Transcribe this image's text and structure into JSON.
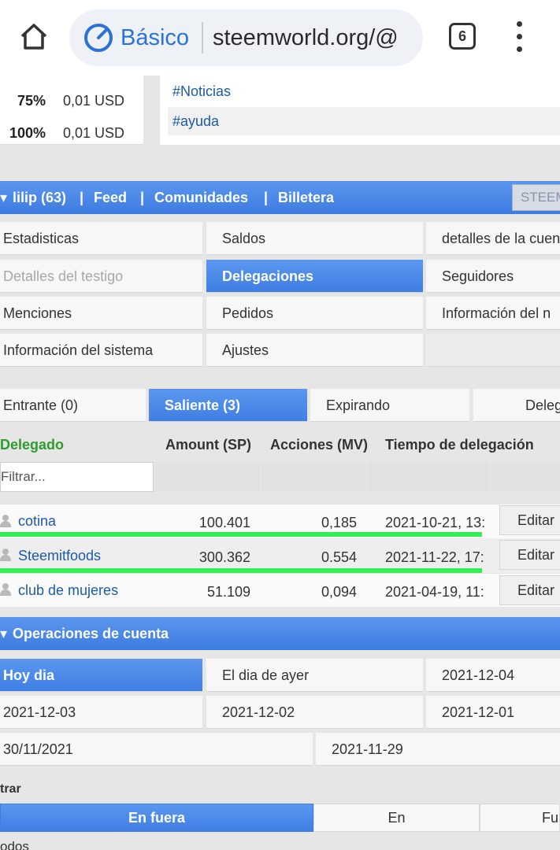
{
  "browser": {
    "mode_label": "Básico",
    "url": "steemworld.org/@",
    "tab_count": "6"
  },
  "prices": [
    {
      "pct": "75%",
      "usd": "0,01 USD"
    },
    {
      "pct": "100%",
      "usd": "0,01 USD"
    }
  ],
  "tags": [
    "#Noticias",
    "#ayuda"
  ],
  "nav": {
    "user": "lilip (63)",
    "sep": "|",
    "feed": "Feed",
    "communities": "Comunidades",
    "wallet": "Billetera",
    "steem": "STEEM"
  },
  "menu": {
    "stats": "Estadisticas",
    "balances": "Saldos",
    "account_details": "detalles de la cuenta",
    "witness_details": "Detalles del testigo",
    "delegations": "Delegaciones",
    "followers": "Seguidores",
    "mentions": "Menciones",
    "orders": "Pedidos",
    "info": "Información del n",
    "system_info": "Información del sistema",
    "settings": "Ajustes"
  },
  "deleg_tabs": {
    "incoming": "Entrante (0)",
    "outgoing": "Saliente (3)",
    "expiring": "Expirando",
    "delegate": "Deleg"
  },
  "table": {
    "headers": {
      "delegatee": "Delegado",
      "amount": "Amount (SP)",
      "shares": "Acciones (MV)",
      "time": "Tiempo de delegación"
    },
    "filter_placeholder": "Filtrar...",
    "edit_label": "Editar",
    "rows": [
      {
        "name": "cotina",
        "amount": "100.401",
        "shares": "0,185",
        "time": "2021-10-21, 13:"
      },
      {
        "name": "Steemitfoods",
        "amount": "300.362",
        "shares": "0.554",
        "time": "2021-11-22, 17:"
      },
      {
        "name": "club de mujeres",
        "amount": "51.109",
        "shares": "0,094",
        "time": "2021-04-19, 11:"
      }
    ]
  },
  "ops": {
    "title": "Operaciones de cuenta",
    "days": [
      "Hoy dia",
      "El dia de ayer",
      "2021-12-04",
      "2021-12-03",
      "2021-12-02",
      "2021-12-01",
      "30/11/2021",
      "2021-11-29"
    ],
    "filter_label": "trar",
    "direction_tabs": [
      "En fuera",
      "En",
      "Fu"
    ],
    "bottom_text": "odos"
  },
  "colors": {
    "accent": "#3d7be0",
    "link": "#1c5aa8",
    "highlight_line": "#33ee55",
    "header_green": "#2e9c2e"
  }
}
